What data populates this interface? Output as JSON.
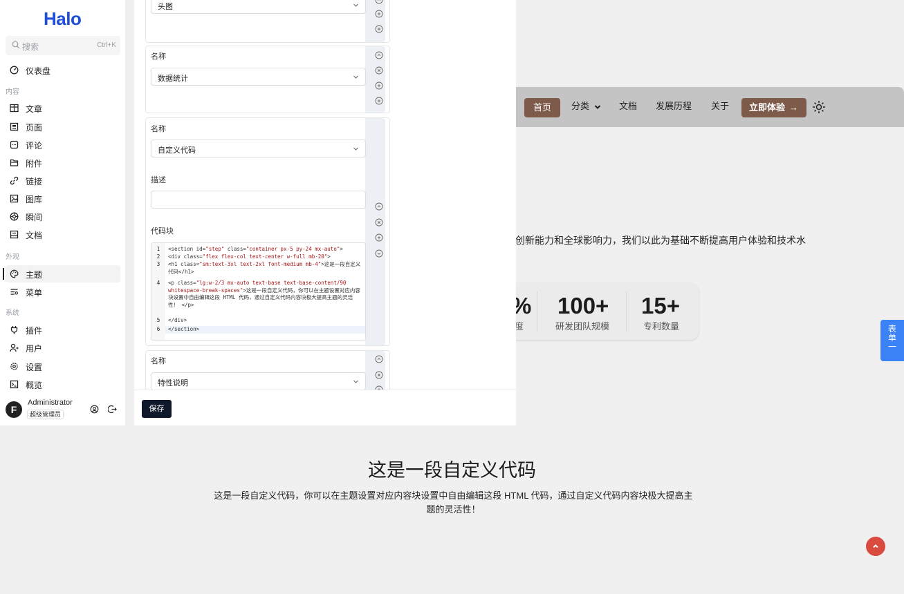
{
  "site": {
    "nav": {
      "home": "首页",
      "category": "分类",
      "docs": "文档",
      "history": "发展历程",
      "about": "关于",
      "cta": "立即体验",
      "cta_arrow": "→",
      "category_chevron": "❯"
    },
    "intro_text": "创新能力和全球影响力，我们以此为基础不断提高用户体验和技术水",
    "stats": [
      {
        "value": "%",
        "label": "度"
      },
      {
        "value": "100+",
        "label": "研发团队规模"
      },
      {
        "value": "15+",
        "label": "专利数量"
      }
    ],
    "float_tab": "表单一",
    "custom_block": {
      "title": "这是一段自定义代码",
      "description": "这是一段自定义代码，你可以在主题设置对应内容块设置中自由编辑这段 HTML 代码，通过自定义代码内容块极大提高主题的灵活性！"
    },
    "colors": {
      "brand": "#7d5a4a",
      "nav_bg": "#c4c4c4",
      "float_tab": "#3b82f6",
      "back_top": "#d94a3f"
    }
  },
  "admin": {
    "logo": "Halo",
    "search": {
      "placeholder": "搜索",
      "shortcut": "Ctrl+K"
    },
    "menu": {
      "dashboard": "仪表盘",
      "group_content": "内容",
      "posts": "文章",
      "pages": "页面",
      "comments": "评论",
      "attachments": "附件",
      "links": "链接",
      "photos": "图库",
      "moments": "瞬间",
      "docs": "文档",
      "group_appearance": "外观",
      "themes": "主题",
      "menus": "菜单",
      "group_system": "系统",
      "plugins": "插件",
      "users": "用户",
      "settings": "设置",
      "overview": "概览"
    },
    "user": {
      "name": "Administrator",
      "role": "超级管理员",
      "avatar_letter": "F"
    }
  },
  "form": {
    "block0": {
      "select_value": "头图"
    },
    "block1": {
      "name_label": "名称",
      "select_value": "数据统计"
    },
    "block2": {
      "name_label": "名称",
      "select_value": "自定义代码",
      "desc_label": "描述",
      "desc_value": "",
      "code_label": "代码块",
      "code_lines": [
        {
          "num": "1",
          "pre": "<section id=",
          "s1": "\"step\"",
          "mid": " class=",
          "s2": "\"container px-5 py-24 mx-auto\"",
          "post": ">"
        },
        {
          "num": "2",
          "pre": "    <div class=",
          "s1": "\"flex flex-col text-center w-full mb-20\"",
          "mid": "",
          "s2": "",
          "post": ">"
        },
        {
          "num": "3",
          "pre": "      <h1 class=",
          "s1": "\"sm:text-3xl text-2xl font-medium mb-4\"",
          "mid": "",
          "s2": "",
          "post": ">这是一段自定义代码</h1>"
        },
        {
          "num": "4",
          "pre": "      <p class=",
          "s1": "\"lg:w-2/3 mx-auto text-base text-base-content/90 whitespace-break-spaces\"",
          "mid": "",
          "s2": "",
          "post": ">这是一段自定义代码，你可以在主题设置对应内容块设置中自由编辑这段 HTML 代码，通过自定义代码内容块极大提高主题的灵活性！ </p>"
        },
        {
          "num": "5",
          "pre": "    </div>",
          "s1": "",
          "mid": "",
          "s2": "",
          "post": ""
        },
        {
          "num": "6",
          "pre": "</section>",
          "s1": "",
          "mid": "",
          "s2": "",
          "post": ""
        }
      ]
    },
    "block3": {
      "name_label": "名称",
      "select_value": "特性说明"
    },
    "save_label": "保存"
  }
}
